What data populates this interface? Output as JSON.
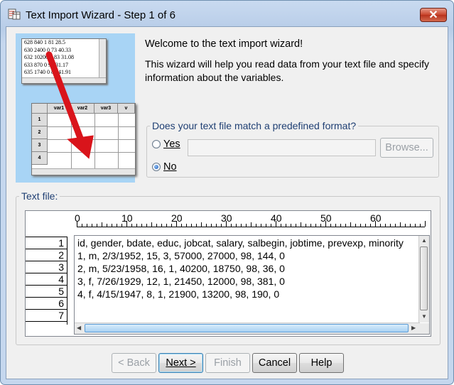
{
  "window": {
    "title": "Text Import Wizard - Step 1 of 6",
    "close_label": "✕"
  },
  "illustration": {
    "data_lines": [
      "628 840 1 81 28.5",
      "630 2400 0 73 40.33",
      "632 10200 0 83 31.08",
      "633 870 0 93 31.17",
      "635 1740 0 83 41.91"
    ],
    "columns": [
      "var1",
      "var2",
      "var3",
      "v"
    ],
    "rows": [
      "1",
      "2",
      "3",
      "4"
    ]
  },
  "welcome": "Welcome to the text import wizard!",
  "description": "This wizard will help you read data from your text file and specify information about the variables.",
  "format_group": {
    "label": "Does your text file match a predefined format?",
    "yes_label": "Yes",
    "no_label": "No",
    "selected": "No",
    "browse_label": "Browse...",
    "format_path": ""
  },
  "text_file": {
    "label": "Text file:",
    "ruler": [
      "0",
      "10",
      "20",
      "30",
      "40",
      "50",
      "60"
    ],
    "line_numbers": [
      "1",
      "2",
      "3",
      "4",
      "5",
      "6",
      "7"
    ],
    "lines": [
      "id, gender, bdate, educ, jobcat, salary, salbegin, jobtime, prevexp, minority",
      "1, m, 2/3/1952, 15, 3, 57000, 27000, 98, 144, 0",
      "2, m, 5/23/1958, 16, 1, 40200, 18750, 98, 36, 0",
      "3, f, 7/26/1929, 12, 1, 21450, 12000, 98, 381, 0",
      "4, f, 4/15/1947, 8, 1, 21900, 13200, 98, 190, 0"
    ]
  },
  "buttons": {
    "back": "< Back",
    "next": "Next >",
    "finish": "Finish",
    "cancel": "Cancel",
    "help": "Help"
  },
  "colors": {
    "accent": "#1f5bbf",
    "close_red": "#c9432b",
    "illustration_bg": "#a8d4f5",
    "arrow_red": "#d9141b"
  }
}
